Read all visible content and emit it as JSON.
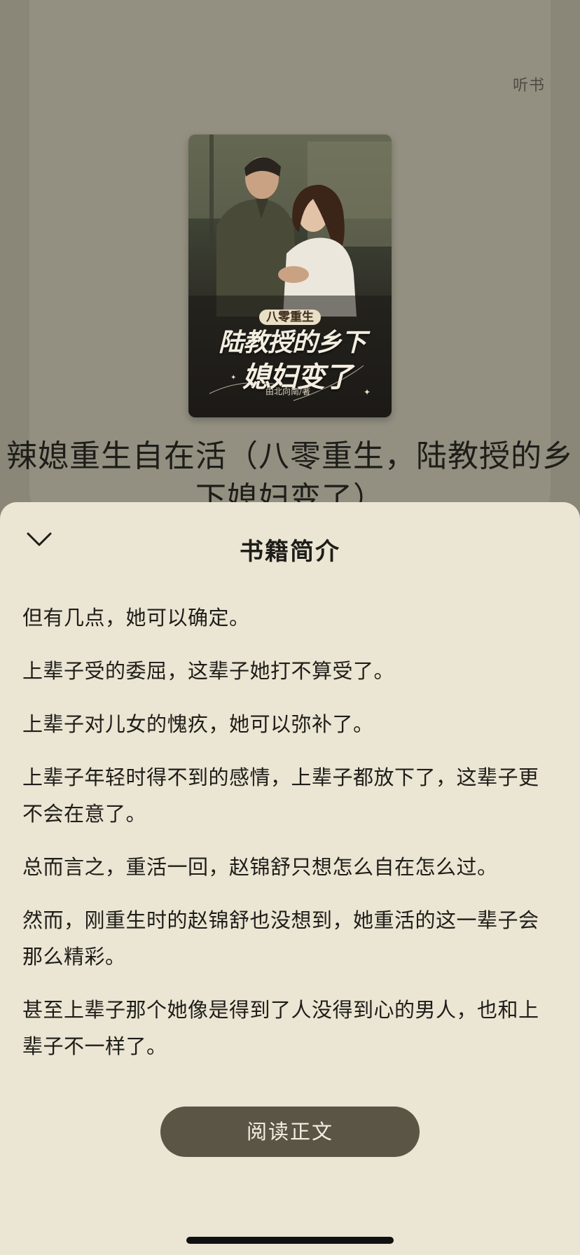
{
  "header": {
    "listen_label": "听书"
  },
  "cover": {
    "series_label": "八零重生",
    "title_line1": "陆教授的乡下",
    "title_line2": "媳妇变了",
    "author_credit": "由北向南/著"
  },
  "book": {
    "title": "辣媳重生自在活（八零重生，陆教授的乡下媳妇变了）"
  },
  "sheet": {
    "title": "书籍简介",
    "paragraphs": [
      "但有几点，她可以确定。",
      "上辈子受的委屈，这辈子她打不算受了。",
      "上辈子对儿女的愧疚，她可以弥补了。",
      "上辈子年轻时得不到的感情，上辈子都放下了，这辈子更不会在意了。",
      "总而言之，重活一回，赵锦舒只想怎么自在怎么过。",
      "然而，刚重生时的赵锦舒也没想到，她重活的这一辈子会那么精彩。",
      "甚至上辈子那个她像是得到了人没得到心的男人，也和上辈子不一样了。"
    ],
    "read_button": "阅读正文"
  },
  "icons": {
    "collapse": "chevron-down-icon"
  },
  "colors": {
    "backdrop": "#8a8778",
    "sheet": "#ebe5d3",
    "button": "#5b5546",
    "text": "#1e1d19"
  }
}
